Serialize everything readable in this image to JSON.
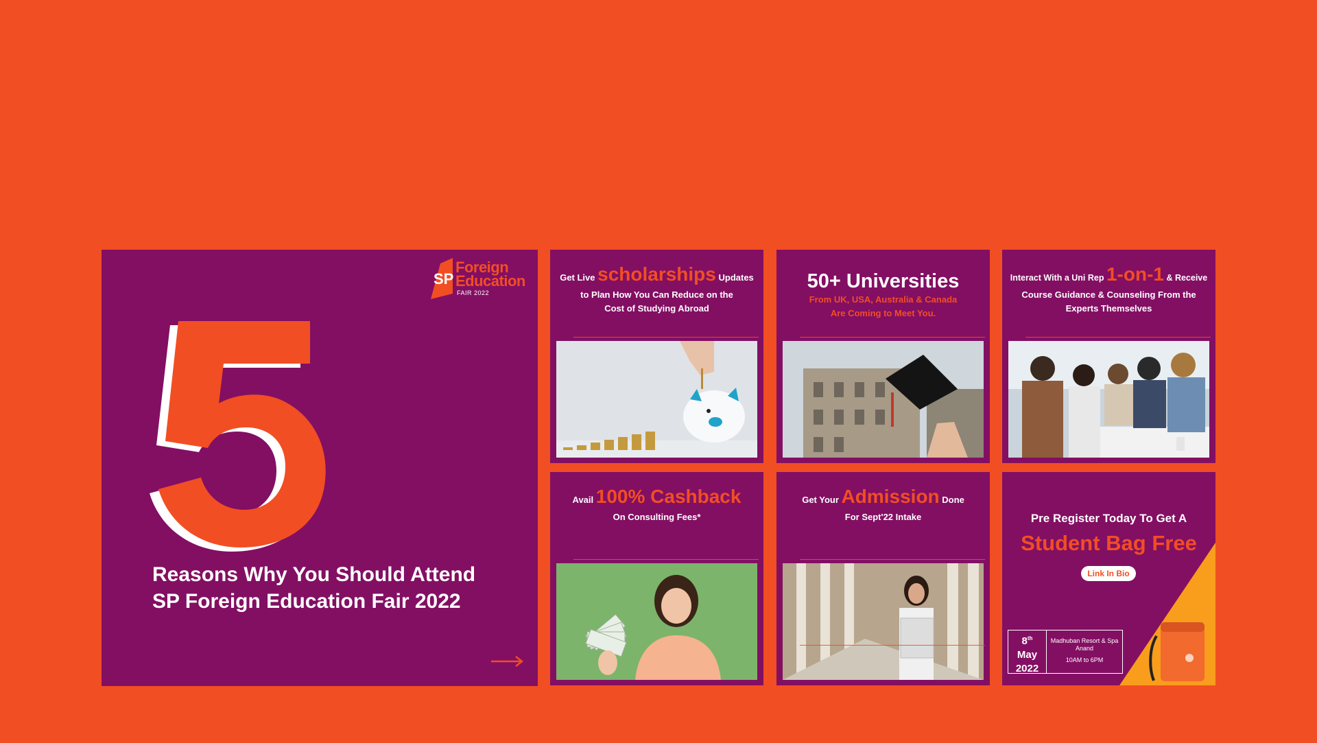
{
  "colors": {
    "background": "#f24e23",
    "panel": "#830f63",
    "accent": "#f24e23",
    "yellow": "#f99d1c",
    "white": "#ffffff"
  },
  "logo": {
    "line1": "Foreign",
    "line2": "Education",
    "line3": "FAIR 2022",
    "mark": "SP"
  },
  "main": {
    "number": "5",
    "headline_line1": "Reasons Why You Should Attend",
    "headline_line2": "SP Foreign Education Fair 2022"
  },
  "cards": {
    "scholarships": {
      "pre": "Get Live",
      "accent": "scholarships",
      "post": "Updates",
      "line2": "to Plan How You Can Reduce on the",
      "line3": "Cost of Studying Abroad"
    },
    "universities": {
      "title": "50+ Universities",
      "line2": "From UK, USA, Australia & Canada",
      "line3": "Are Coming to Meet You."
    },
    "onetoone": {
      "pre": "Interact With a Uni Rep",
      "accent": "1-on-1",
      "post": "& Receive",
      "line2": "Course Guidance & Counseling From the",
      "line3": "Experts Themselves"
    },
    "cashback": {
      "pre": "Avail",
      "accent": "100% Cashback",
      "line2": "On Consulting Fees*"
    },
    "admission": {
      "pre": "Get Your",
      "accent": "Admission",
      "post": "Done",
      "line2": "For Sept'22 Intake"
    },
    "bag": {
      "line1": "Pre Register Today To Get A",
      "accent": "Student Bag Free",
      "pill": "Link In Bio",
      "date_day": "8",
      "date_sup": "th",
      "date_month": "May",
      "date_year": "2022",
      "venue1": "Madhuban Resort & Spa",
      "venue2": "Anand",
      "time": "10AM to 6PM"
    }
  },
  "icons": {
    "arrow": "arrow-right-icon"
  }
}
